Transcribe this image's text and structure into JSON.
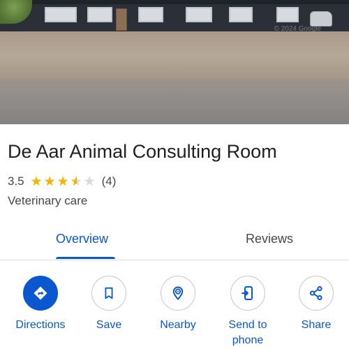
{
  "place": {
    "name": "De Aar Animal Consulting Room",
    "rating": "3.5",
    "rating_value": 3.5,
    "rating_max": 5,
    "review_count": "(4)",
    "category": "Veterinary care"
  },
  "photo": {
    "watermark": "© 2024 Google"
  },
  "tabs": [
    {
      "label": "Overview",
      "selected": true
    },
    {
      "label": "Reviews",
      "selected": false
    }
  ],
  "actions": [
    {
      "label": "Directions",
      "icon": "directions-icon"
    },
    {
      "label": "Save",
      "icon": "bookmark-icon"
    },
    {
      "label": "Nearby",
      "icon": "nearby-pin-icon"
    },
    {
      "label": "Send to phone",
      "icon": "send-to-phone-icon"
    },
    {
      "label": "Share",
      "icon": "share-icon"
    }
  ],
  "colors": {
    "accent": "#0b57d0",
    "star": "#f4b400",
    "star_empty": "#d9d9d9"
  }
}
